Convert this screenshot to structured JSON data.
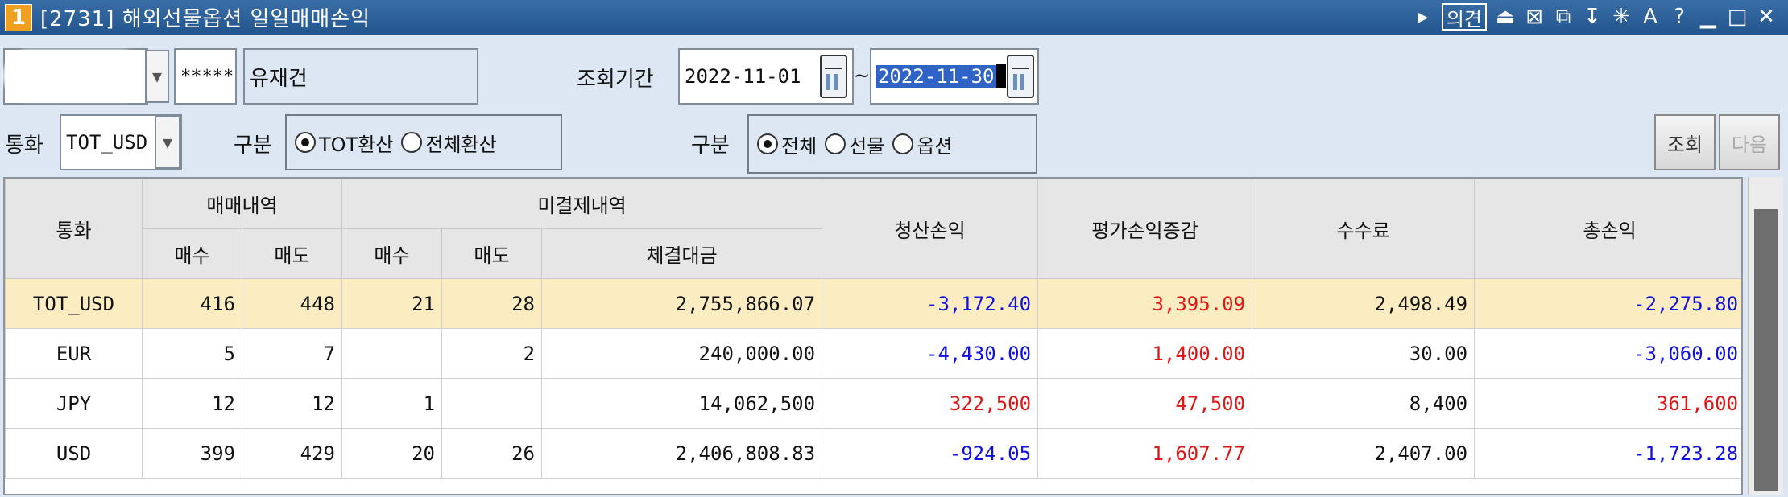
{
  "window": {
    "number": "1",
    "title": "[2731] 해외선물옵션 일일매매손익",
    "opinion_label": "의견"
  },
  "account": {
    "masked": "*****",
    "holder_name": "유재건"
  },
  "period": {
    "label": "조회기간",
    "from": "2022-11-01",
    "separator": "~",
    "to": "2022-11-30"
  },
  "currency": {
    "label": "통화",
    "value": "TOT_USD"
  },
  "category1": {
    "label": "구분",
    "options": [
      "TOT환산",
      "전체환산"
    ],
    "selected": 0
  },
  "category2": {
    "label": "구분",
    "options": [
      "전체",
      "선물",
      "옵션"
    ],
    "selected": 0
  },
  "buttons": {
    "query": "조회",
    "next": "다음"
  },
  "table": {
    "headers": {
      "currency": "통화",
      "trade_group": "매매내역",
      "open_group": "미결제내역",
      "buy": "매수",
      "sell": "매도",
      "contract_amount": "체결대금",
      "realized_pl": "청산손익",
      "eval_change": "평가손익증감",
      "fee": "수수료",
      "total_pl": "총손익"
    },
    "rows": [
      {
        "currency": "TOT_USD",
        "trade_buy": "416",
        "trade_sell": "448",
        "open_buy": "21",
        "open_sell": "28",
        "amount": "2,755,866.07",
        "realized": "-3,172.40",
        "eval": "3,395.09",
        "fee": "2,498.49",
        "total": "-2,275.80"
      },
      {
        "currency": "EUR",
        "trade_buy": "5",
        "trade_sell": "7",
        "open_buy": "",
        "open_sell": "2",
        "amount": "240,000.00",
        "realized": "-4,430.00",
        "eval": "1,400.00",
        "fee": "30.00",
        "total": "-3,060.00"
      },
      {
        "currency": "JPY",
        "trade_buy": "12",
        "trade_sell": "12",
        "open_buy": "1",
        "open_sell": "",
        "amount": "14,062,500",
        "realized": "322,500",
        "eval": "47,500",
        "fee": "8,400",
        "total": "361,600"
      },
      {
        "currency": "USD",
        "trade_buy": "399",
        "trade_sell": "429",
        "open_buy": "20",
        "open_sell": "26",
        "amount": "2,406,808.83",
        "realized": "-924.05",
        "eval": "1,607.77",
        "fee": "2,407.00",
        "total": "-1,723.28"
      }
    ]
  },
  "colors": {
    "negative": "#1010e0",
    "positive": "#e01515",
    "summary_row": "#fcecc2",
    "titlebar": "#2c5f98"
  }
}
